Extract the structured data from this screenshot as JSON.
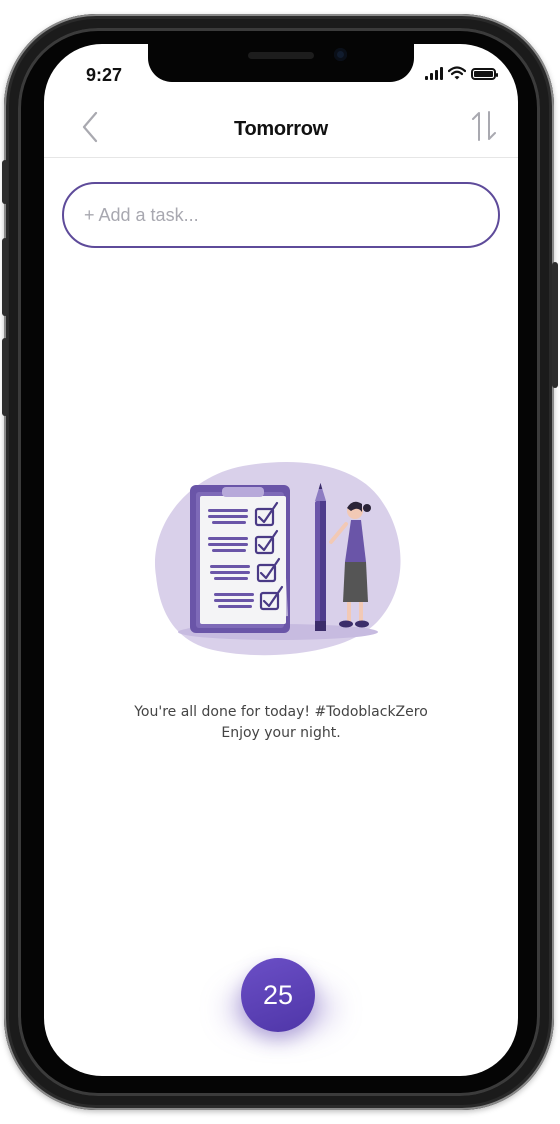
{
  "status_bar": {
    "time": "9:27",
    "icons": [
      "signal-icon",
      "wifi-icon",
      "battery-icon"
    ]
  },
  "header": {
    "title": "Tomorrow",
    "back_icon": "chevron-left-icon",
    "sort_icon": "sort-arrows-icon"
  },
  "add_task": {
    "placeholder": "+ Add a task..."
  },
  "empty_state": {
    "illustration": "checklist-woman-illustration",
    "line1": "You're all done for today! #TodoblackZero",
    "line2": "Enjoy your night."
  },
  "fab": {
    "label": "25"
  },
  "colors": {
    "accent": "#5e4b9a",
    "fab": "#5b3fbf",
    "illustration_bg": "#d9d0ea"
  }
}
